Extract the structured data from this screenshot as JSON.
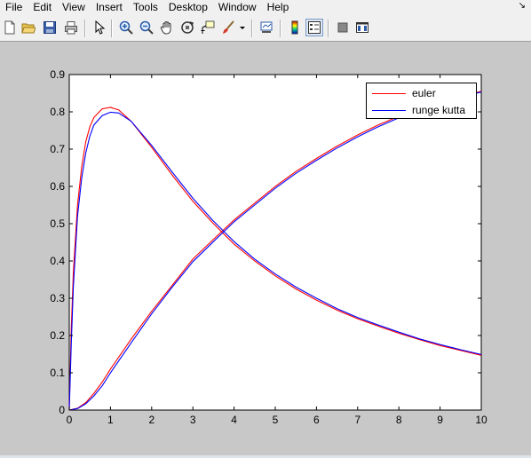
{
  "menubar": {
    "items": [
      "File",
      "Edit",
      "View",
      "Insert",
      "Tools",
      "Desktop",
      "Window",
      "Help"
    ],
    "arrow_icon": "dock-arrow-icon"
  },
  "toolbar": {
    "icons": [
      "new-figure-icon",
      "open-file-icon",
      "save-icon",
      "print-icon",
      "select-arrow-icon",
      "zoom-in-icon",
      "zoom-out-icon",
      "pan-hand-icon",
      "rotate-3d-icon",
      "data-cursor-icon",
      "brush-icon",
      "brush-dropdown-icon",
      "link-plot-icon",
      "insert-colorbar-icon",
      "insert-legend-icon",
      "hide-plot-tools-icon",
      "show-plot-tools-icon"
    ]
  },
  "colors": {
    "euler": "#ff0000",
    "runge_kutta": "#0000ff",
    "background": "#c8c8c8",
    "axes_bg": "#ffffff"
  },
  "chart_data": {
    "type": "line",
    "title": "",
    "xlabel": "",
    "ylabel": "",
    "xlim": [
      0,
      10
    ],
    "ylim": [
      0,
      0.9
    ],
    "xticks": [
      "0",
      "1",
      "2",
      "3",
      "4",
      "5",
      "6",
      "7",
      "8",
      "9",
      "10"
    ],
    "yticks": [
      "0",
      "0.1",
      "0.2",
      "0.3",
      "0.4",
      "0.5",
      "0.6",
      "0.7",
      "0.8",
      "0.9"
    ],
    "legend": {
      "placement": "top-right",
      "entries": [
        "euler",
        "runge kutta"
      ]
    },
    "grid": false,
    "series": [
      {
        "name": "euler",
        "color": "#ff0000",
        "x": [
          0,
          0.05,
          0.1,
          0.2,
          0.3,
          0.4,
          0.5,
          0.6,
          0.8,
          1.0,
          1.2,
          1.5,
          2,
          2.5,
          3,
          3.5,
          4,
          4.5,
          5,
          5.5,
          6,
          6.5,
          7,
          7.5,
          8,
          8.5,
          9,
          9.5,
          10
        ],
        "y": [
          0,
          0.22,
          0.37,
          0.55,
          0.65,
          0.72,
          0.76,
          0.785,
          0.808,
          0.812,
          0.805,
          0.775,
          0.705,
          0.63,
          0.56,
          0.5,
          0.445,
          0.4,
          0.36,
          0.325,
          0.295,
          0.268,
          0.245,
          0.225,
          0.206,
          0.189,
          0.173,
          0.16,
          0.147
        ]
      },
      {
        "name": "euler",
        "color": "#ff0000",
        "x": [
          0,
          0.2,
          0.4,
          0.6,
          0.8,
          1,
          1.5,
          2,
          2.5,
          3,
          3.5,
          4,
          4.5,
          5,
          5.5,
          6,
          6.5,
          7,
          7.5,
          8,
          8.5,
          9,
          9.5,
          10
        ],
        "y": [
          0,
          0.005,
          0.02,
          0.045,
          0.075,
          0.11,
          0.19,
          0.265,
          0.335,
          0.405,
          0.458,
          0.51,
          0.555,
          0.6,
          0.64,
          0.675,
          0.708,
          0.738,
          0.765,
          0.788,
          0.81,
          0.828,
          0.842,
          0.855
        ]
      },
      {
        "name": "runge kutta",
        "color": "#0000ff",
        "x": [
          0,
          0.05,
          0.1,
          0.2,
          0.3,
          0.4,
          0.5,
          0.6,
          0.8,
          1.0,
          1.2,
          1.5,
          2,
          2.5,
          3,
          3.5,
          4,
          4.5,
          5,
          5.5,
          6,
          6.5,
          7,
          7.5,
          8,
          8.5,
          9,
          9.5,
          10
        ],
        "y": [
          0,
          0.18,
          0.33,
          0.52,
          0.62,
          0.69,
          0.735,
          0.765,
          0.79,
          0.799,
          0.797,
          0.775,
          0.71,
          0.638,
          0.568,
          0.507,
          0.452,
          0.405,
          0.365,
          0.33,
          0.3,
          0.272,
          0.248,
          0.228,
          0.209,
          0.191,
          0.176,
          0.162,
          0.149
        ]
      },
      {
        "name": "runge kutta",
        "color": "#0000ff",
        "x": [
          0,
          0.2,
          0.4,
          0.6,
          0.8,
          1,
          1.5,
          2,
          2.5,
          3,
          3.5,
          4,
          4.5,
          5,
          5.5,
          6,
          6.5,
          7,
          7.5,
          8,
          8.5,
          9,
          9.5,
          10
        ],
        "y": [
          0,
          0.004,
          0.017,
          0.038,
          0.065,
          0.1,
          0.18,
          0.258,
          0.33,
          0.398,
          0.452,
          0.505,
          0.55,
          0.595,
          0.635,
          0.67,
          0.703,
          0.733,
          0.76,
          0.784,
          0.806,
          0.825,
          0.84,
          0.853
        ]
      }
    ]
  }
}
